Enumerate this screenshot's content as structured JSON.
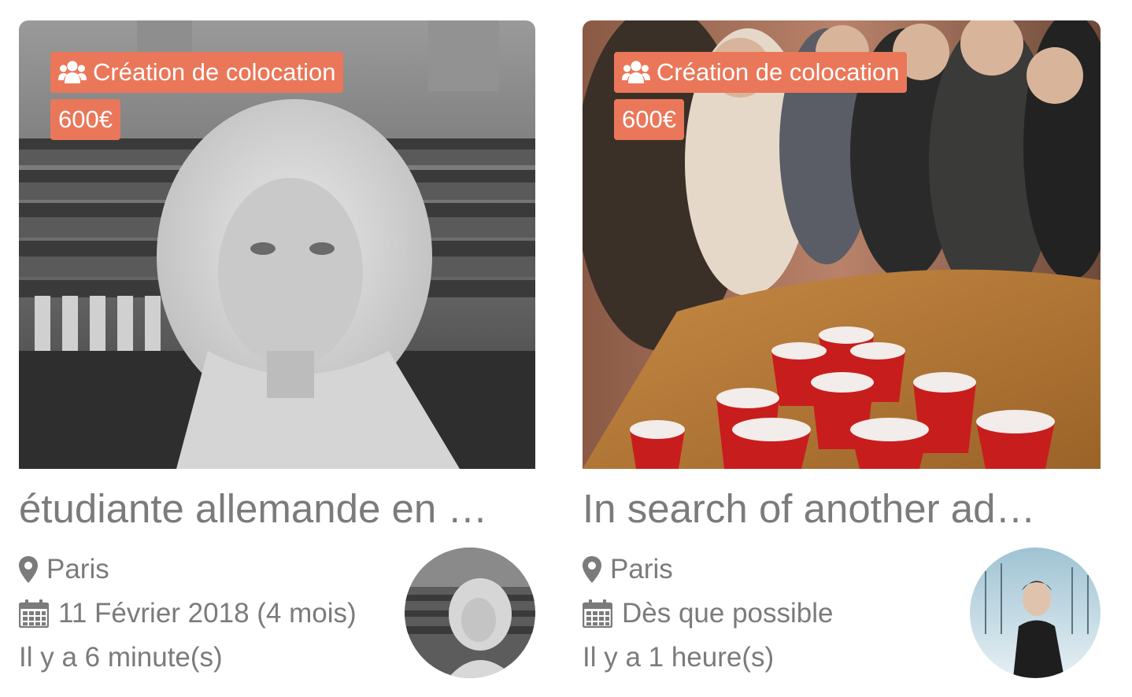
{
  "listings": [
    {
      "type_label": "Création de colocation",
      "price": "600€",
      "title": "étudiante allemande en …",
      "location": "Paris",
      "date": "11 Février 2018 (4 mois)",
      "posted": "Il y a 6 minute(s)"
    },
    {
      "type_label": "Création de colocation",
      "price": "600€",
      "title": "In search of another ad…",
      "location": "Paris",
      "date": "Dès que possible",
      "posted": "Il y a 1 heure(s)"
    }
  ],
  "colors": {
    "badge": "#ea7759",
    "text": "#7b7b7b"
  },
  "icons": {
    "badge": "users-icon",
    "location": "pin-icon",
    "date": "calendar-icon"
  }
}
